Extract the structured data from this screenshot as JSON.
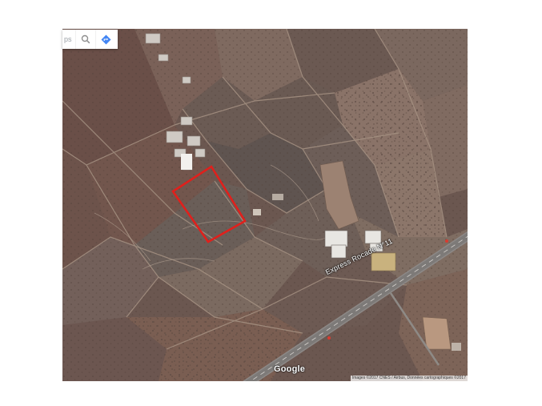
{
  "search": {
    "placeholder_fragment": "ps"
  },
  "map": {
    "road_label": "Express Rocade N°11",
    "logo_text": "Google",
    "attribution_text": "Images ©2017 CNES / Airbus, Données cartographiques ©2017",
    "parcel_outline_color": "#e0201c"
  },
  "icons": {
    "search": "search-icon",
    "directions": "directions-icon"
  }
}
